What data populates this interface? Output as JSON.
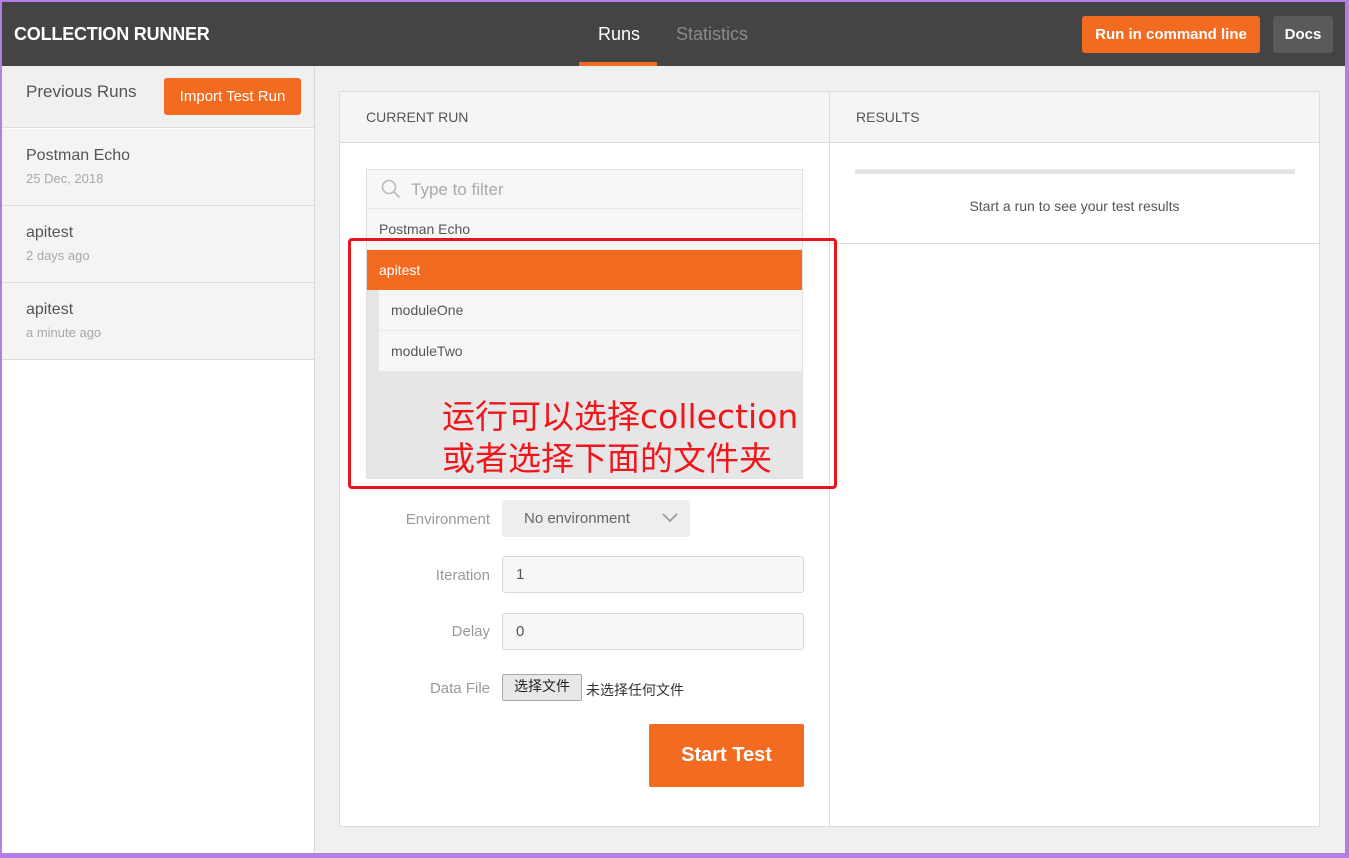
{
  "header": {
    "title": "COLLECTION RUNNER",
    "tabs": [
      {
        "label": "Runs",
        "active": true
      },
      {
        "label": "Statistics",
        "active": false
      }
    ],
    "run_cmd_label": "Run in command line",
    "docs_label": "Docs"
  },
  "sidebar": {
    "title": "Previous Runs",
    "import_label": "Import Test Run",
    "runs": [
      {
        "name": "Postman Echo",
        "time": "25 Dec, 2018"
      },
      {
        "name": "apitest",
        "time": "2 days ago"
      },
      {
        "name": "apitest",
        "time": "a minute ago"
      }
    ]
  },
  "current_run": {
    "title": "CURRENT RUN",
    "filter_placeholder": "Type to filter",
    "collections": [
      {
        "name": "Postman Echo",
        "selected": false
      },
      {
        "name": "apitest",
        "selected": true
      }
    ],
    "folders": [
      "moduleOne",
      "moduleTwo"
    ],
    "annotation": [
      "运行可以选择collection",
      "或者选择下面的文件夹"
    ],
    "environment_label": "Environment",
    "environment_value": "No environment",
    "iteration_label": "Iteration",
    "iteration_value": "1",
    "delay_label": "Delay",
    "delay_value": "0",
    "datafile_label": "Data File",
    "datafile_button": "选择文件",
    "datafile_status": "未选择任何文件",
    "start_label": "Start Test"
  },
  "results": {
    "title": "RESULTS",
    "empty_text": "Start a run to see your test results"
  },
  "colors": {
    "accent": "#f26b21",
    "header_bg": "#444444",
    "annotation": "#e8161c"
  }
}
